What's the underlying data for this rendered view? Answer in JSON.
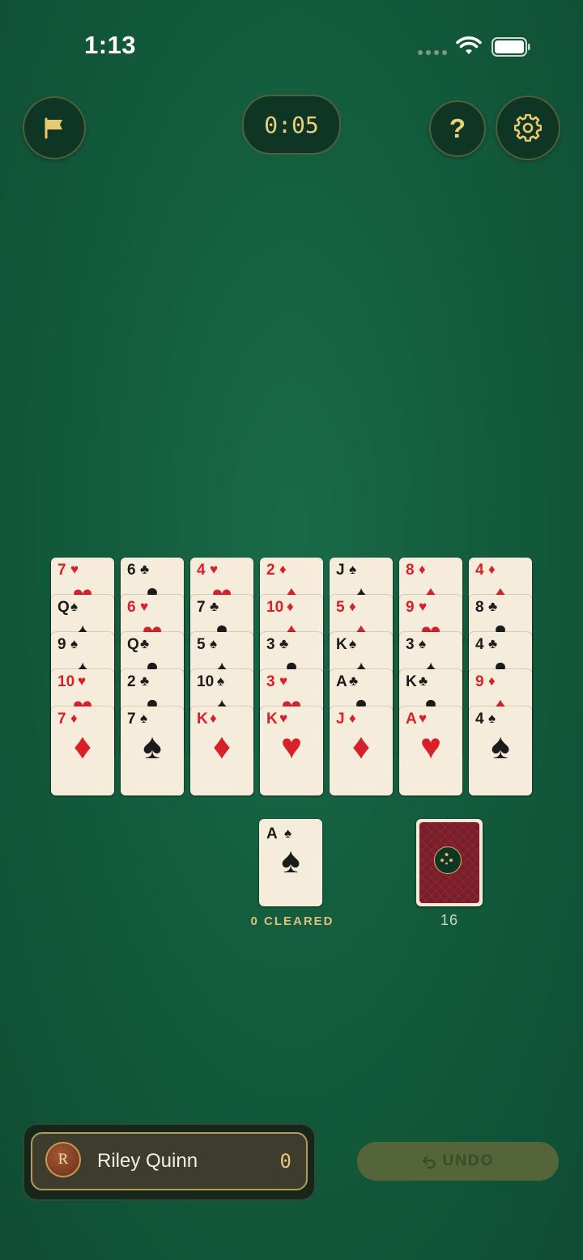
{
  "status_bar": {
    "time": "1:13"
  },
  "header": {
    "timer": "0:05",
    "help_label": "?",
    "icons": {
      "flag": "flag-icon",
      "settings": "gear-icon",
      "wifi": "wifi-icon",
      "battery": "battery-icon"
    }
  },
  "tableau": [
    {
      "cards": [
        {
          "rank": "7",
          "suit": "♥",
          "color": "red"
        },
        {
          "rank": "Q",
          "suit": "♠",
          "color": "black"
        },
        {
          "rank": "9",
          "suit": "♠",
          "color": "black"
        },
        {
          "rank": "10",
          "suit": "♥",
          "color": "red"
        },
        {
          "rank": "7",
          "suit": "♦",
          "color": "red"
        }
      ]
    },
    {
      "cards": [
        {
          "rank": "6",
          "suit": "♣",
          "color": "black"
        },
        {
          "rank": "6",
          "suit": "♥",
          "color": "red"
        },
        {
          "rank": "Q",
          "suit": "♣",
          "color": "black"
        },
        {
          "rank": "2",
          "suit": "♣",
          "color": "black"
        },
        {
          "rank": "7",
          "suit": "♠",
          "color": "black"
        }
      ]
    },
    {
      "cards": [
        {
          "rank": "4",
          "suit": "♥",
          "color": "red"
        },
        {
          "rank": "7",
          "suit": "♣",
          "color": "black"
        },
        {
          "rank": "5",
          "suit": "♠",
          "color": "black"
        },
        {
          "rank": "10",
          "suit": "♠",
          "color": "black"
        },
        {
          "rank": "K",
          "suit": "♦",
          "color": "red"
        }
      ]
    },
    {
      "cards": [
        {
          "rank": "2",
          "suit": "♦",
          "color": "red"
        },
        {
          "rank": "10",
          "suit": "♦",
          "color": "red"
        },
        {
          "rank": "3",
          "suit": "♣",
          "color": "black"
        },
        {
          "rank": "3",
          "suit": "♥",
          "color": "red"
        },
        {
          "rank": "K",
          "suit": "♥",
          "color": "red"
        }
      ]
    },
    {
      "cards": [
        {
          "rank": "J",
          "suit": "♠",
          "color": "black"
        },
        {
          "rank": "5",
          "suit": "♦",
          "color": "red"
        },
        {
          "rank": "K",
          "suit": "♠",
          "color": "black"
        },
        {
          "rank": "A",
          "suit": "♣",
          "color": "black"
        },
        {
          "rank": "J",
          "suit": "♦",
          "color": "red"
        }
      ]
    },
    {
      "cards": [
        {
          "rank": "8",
          "suit": "♦",
          "color": "red"
        },
        {
          "rank": "9",
          "suit": "♥",
          "color": "red"
        },
        {
          "rank": "3",
          "suit": "♠",
          "color": "black"
        },
        {
          "rank": "K",
          "suit": "♣",
          "color": "black"
        },
        {
          "rank": "A",
          "suit": "♥",
          "color": "red"
        }
      ]
    },
    {
      "cards": [
        {
          "rank": "4",
          "suit": "♦",
          "color": "red"
        },
        {
          "rank": "8",
          "suit": "♣",
          "color": "black"
        },
        {
          "rank": "4",
          "suit": "♣",
          "color": "black"
        },
        {
          "rank": "9",
          "suit": "♦",
          "color": "red"
        },
        {
          "rank": "4",
          "suit": "♠",
          "color": "black"
        }
      ]
    }
  ],
  "waste": {
    "rank": "A",
    "suit": "♠",
    "cleared_label": "0 CLEARED"
  },
  "stock": {
    "count": "16"
  },
  "player": {
    "initial": "R",
    "name": "Riley Quinn",
    "score": "0"
  },
  "undo": {
    "label": "UNDO"
  },
  "colors": {
    "red_suit": "#d8202a",
    "black_suit": "#1b1b1b",
    "accent_gold": "#eccf7c",
    "felt": "#145e3f"
  }
}
